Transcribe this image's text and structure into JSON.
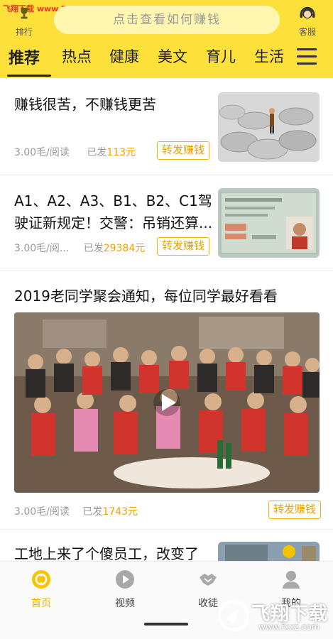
{
  "watermark_top": "飞翔下载 www.FXXZ.com",
  "header": {
    "rank_label": "排行",
    "search_placeholder": "点击查看如何赚钱",
    "service_label": "客服"
  },
  "tabs": [
    "推荐",
    "热点",
    "健康",
    "美文",
    "育儿",
    "生活"
  ],
  "feed": [
    {
      "title": "赚钱很苦，不赚钱更苦",
      "rate": "3.00毛/阅读",
      "sent_label": "已发",
      "sent_amount": "113元",
      "button": "转发赚钱"
    },
    {
      "title_line1": "A1、A2、A3、B1、B2、C1驾",
      "title_line2": "驶证新规定！交警：吊销还算...",
      "rate": "3.00毛/阅...",
      "sent_label": "已发",
      "sent_amount": "29384元",
      "button": "转发赚钱"
    },
    {
      "title": "2019老同学聚会通知，每位同学最好看看",
      "rate": "3.00毛/阅读",
      "sent_label": "已发",
      "sent_amount": "1743元",
      "button": "转发赚钱"
    },
    {
      "title": "工地上来了个傻员工，改变了"
    }
  ],
  "bottom_nav": [
    {
      "label": "首页",
      "icon": "home-icon"
    },
    {
      "label": "视频",
      "icon": "video-play-icon"
    },
    {
      "label": "收徒",
      "icon": "handshake-icon"
    },
    {
      "label": "我的",
      "icon": "profile-icon"
    }
  ],
  "watermark_bottom": {
    "logo_text": "飞翔下载",
    "url": "www.fxxz.com"
  },
  "colors": {
    "brand_yellow": "#fde13a",
    "earned_orange": "#f0a200",
    "button_border": "#f0b400"
  }
}
